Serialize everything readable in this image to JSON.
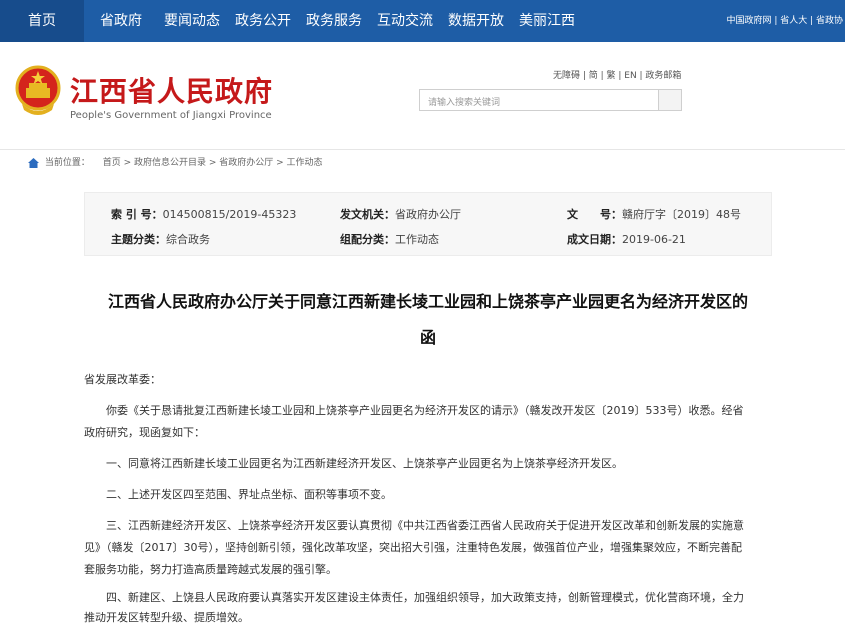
{
  "nav": {
    "items": [
      "首页",
      "省政府",
      "要闻动态",
      "政务公开",
      "政务服务",
      "互动交流",
      "数据开放",
      "美丽江西"
    ],
    "right_links": "中国政府网 | 省人大 | 省政协"
  },
  "header": {
    "title": "江西省人民政府",
    "subtitle": "People's Government of Jiangxi Province",
    "util_links": "无障碍 | 简 | 繁 | EN | 政务邮箱",
    "search_placeholder": "请输入搜索关键词"
  },
  "breadcrumb": {
    "label": "当前位置：",
    "path": "首页 > 政府信息公开目录 > 省政府办公厅 > 工作动态"
  },
  "meta": {
    "index_label": "索 引 号：",
    "index_value": "014500815/2019-45323",
    "issuer_label": "发文机关：",
    "issuer_value": "省政府办公厅",
    "doc_no_label": "文　　号：",
    "doc_no_value": "赣府厅字〔2019〕48号",
    "category_label": "主题分类：",
    "category_value": "综合政务",
    "genre_label": "组配分类：",
    "genre_value": "工作动态",
    "date_label": "成文日期：",
    "date_value": "2019-06-21"
  },
  "article": {
    "title_line1": "江西省人民政府办公厅关于同意江西新建长堎工业园和上饶茶亭产业园更名为经济开发区的",
    "title_line2": "函",
    "salutation": "省发展改革委：",
    "p1_l1": "你委《关于恳请批复江西新建长堎工业园和上饶茶亭产业园更名为经济开发区的请示》（赣发改开发区〔2019〕533号）收悉。经省",
    "p1_l2": "政府研究，现函复如下：",
    "p2": "一、同意将江西新建长堎工业园更名为江西新建经济开发区、上饶茶亭产业园更名为上饶茶亭经济开发区。",
    "p3": "二、上述开发区四至范围、界址点坐标、面积等事项不变。",
    "p4_l1": "三、江西新建经济开发区、上饶茶亭经济开发区要认真贯彻《中共江西省委江西省人民政府关于促进开发区改革和创新发展的实施意",
    "p4_l2": "见》（赣发〔2017〕30号），坚持创新引领，强化改革攻坚，突出招大引强，注重特色发展，做强首位产业，增强集聚效应，不断完善配",
    "p4_l3": "套服务功能，努力打造高质量跨越式发展的强引擎。",
    "p5_l1": "四、新建区、上饶县人民政府要认真落实开发区建设主体责任，加强组织领导，加大政策支持，创新管理模式，优化营商环境，全力",
    "p5_l2": "推动开发区转型升级、提质增效。"
  },
  "colors": {
    "nav_bg": "#1e5da6",
    "title_red": "#c5191a"
  }
}
